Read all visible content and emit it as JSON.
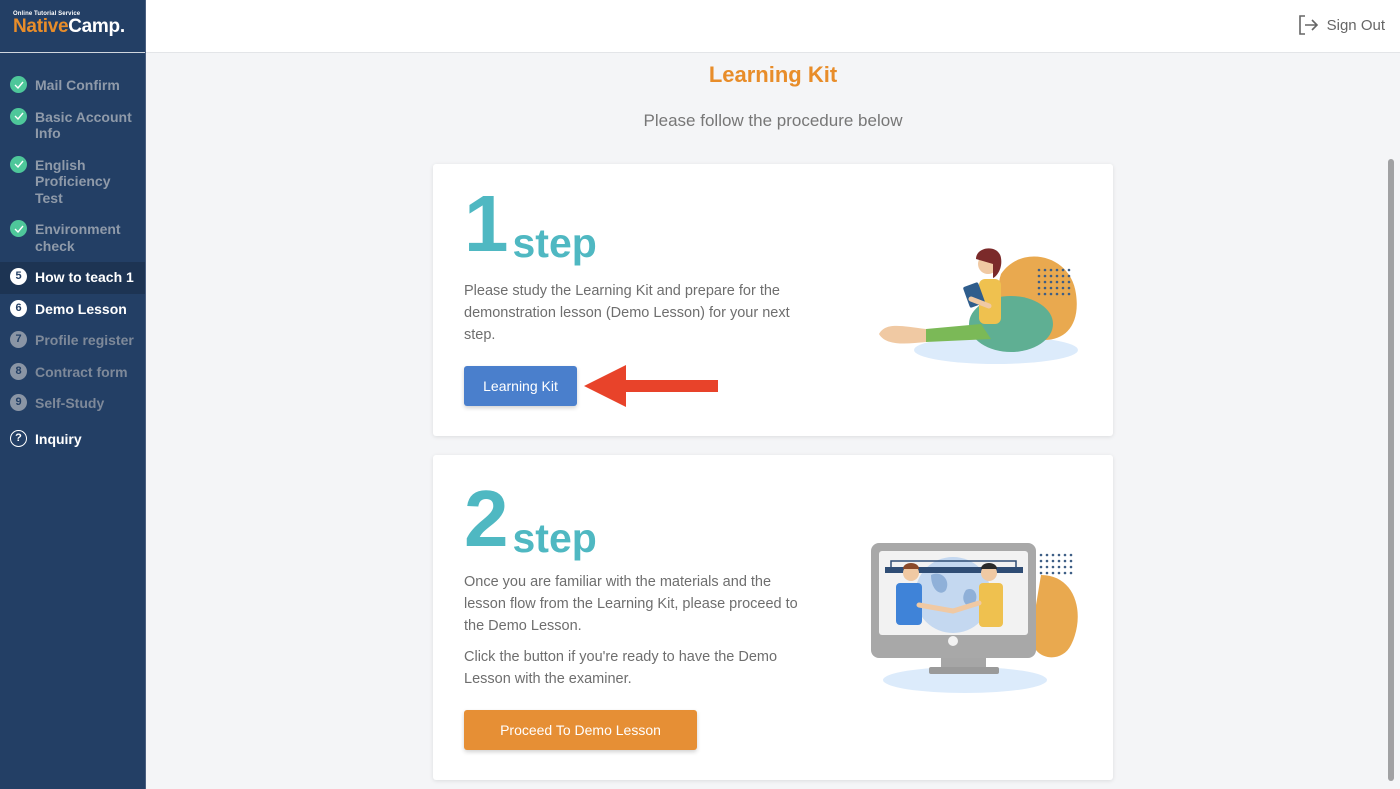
{
  "brand": {
    "tagline": "Online Tutorial Service",
    "name_part1": "Native",
    "name_part2": "Camp."
  },
  "header": {
    "signout_label": "Sign Out",
    "signout_icon": "sign-out-icon"
  },
  "sidebar": {
    "items": [
      {
        "label": "Mail Confirm",
        "state": "done",
        "icon": "check-icon"
      },
      {
        "label": "Basic Account Info",
        "state": "done",
        "icon": "check-icon"
      },
      {
        "label": "English Proficiency Test",
        "state": "done",
        "icon": "check-icon"
      },
      {
        "label": "Environment check",
        "state": "done",
        "icon": "check-icon"
      },
      {
        "label": "How to teach 1",
        "state": "active",
        "number": "5"
      },
      {
        "label": "Demo Lesson",
        "state": "current",
        "number": "6"
      },
      {
        "label": "Profile register",
        "state": "todo",
        "number": "7"
      },
      {
        "label": "Contract form",
        "state": "todo",
        "number": "8"
      },
      {
        "label": "Self-Study",
        "state": "todo",
        "number": "9"
      },
      {
        "label": "Inquiry",
        "state": "help",
        "icon": "help-icon",
        "glyph": "?"
      }
    ]
  },
  "main": {
    "title": "Learning Kit",
    "subtitle": "Please follow the procedure below",
    "steps": [
      {
        "number": "1",
        "word": "step",
        "paragraphs": [
          "Please study the Learning Kit and prepare for the demonstration lesson (Demo Lesson) for your next step."
        ],
        "button_label": "Learning Kit",
        "illustration": "woman-reading-book-illustration"
      },
      {
        "number": "2",
        "word": "step",
        "paragraphs": [
          "Once you are familiar with the materials and the lesson flow from the Learning Kit, please proceed to the Demo Lesson.",
          "Click the button if you're ready to have the Demo Lesson with the examiner."
        ],
        "button_label": "Proceed To Demo Lesson",
        "illustration": "monitor-handshake-illustration"
      }
    ]
  },
  "colors": {
    "sidebar_bg": "#233f65",
    "accent_orange": "#e88d2a",
    "step_teal": "#4fb8c2",
    "button_blue": "#4a7fcc",
    "button_orange": "#e68f35",
    "check_green": "#4ec79a",
    "annotation_arrow": "#e8432a"
  }
}
